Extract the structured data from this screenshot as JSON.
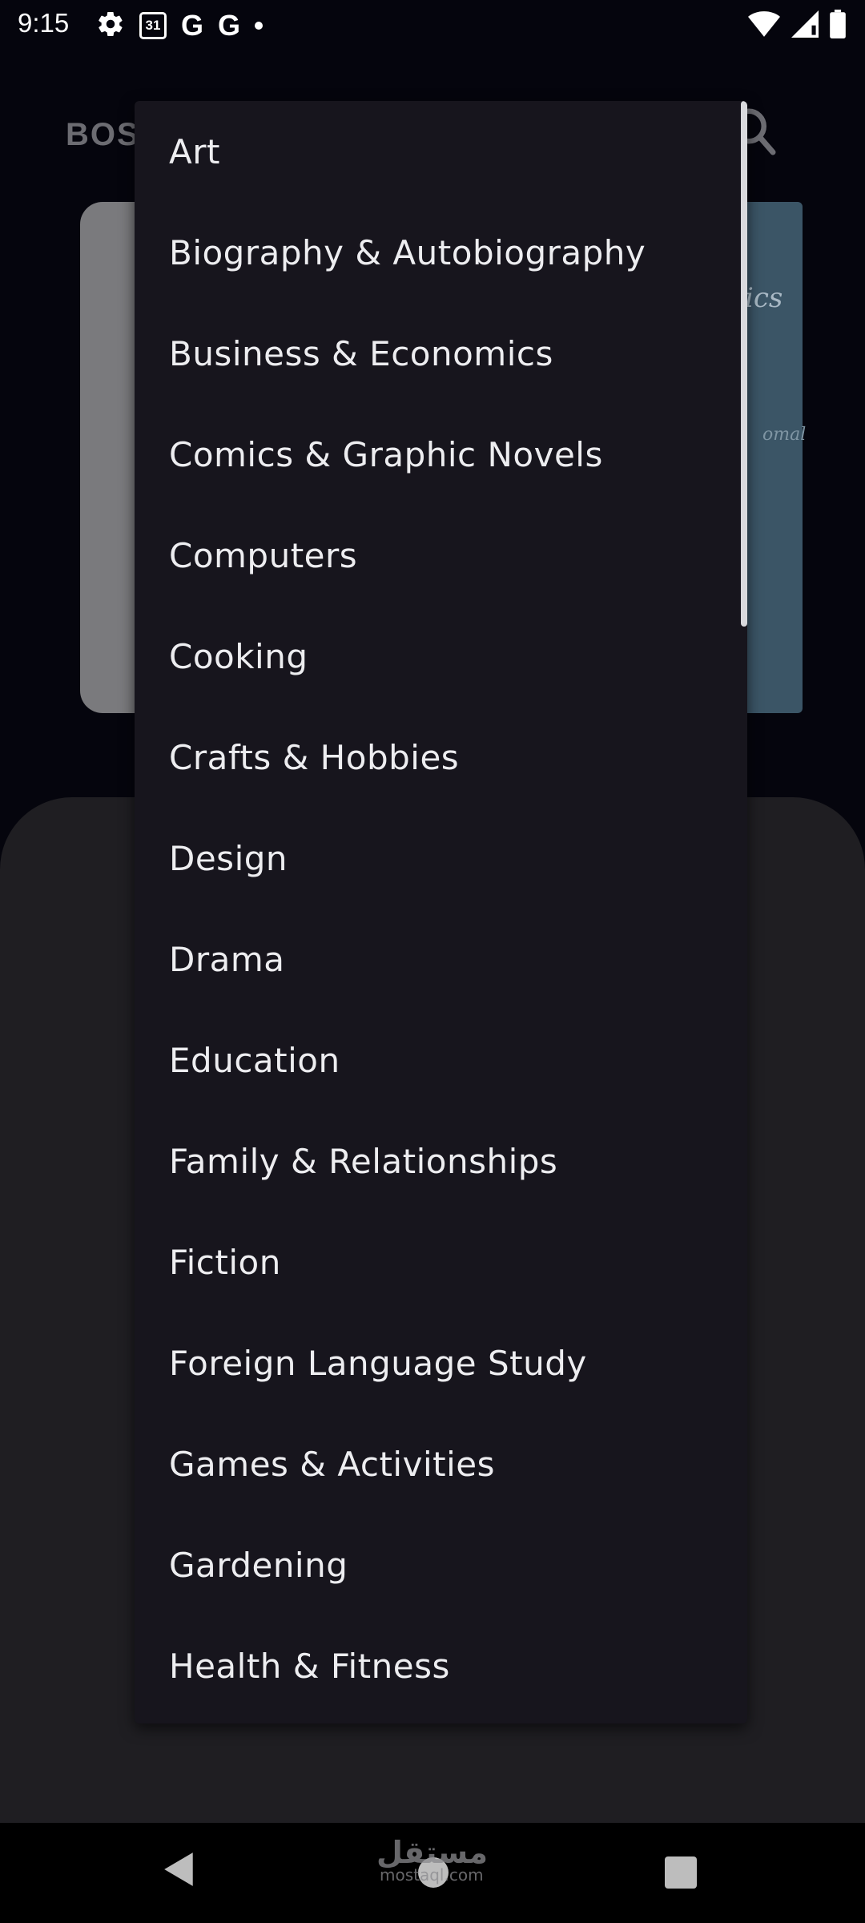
{
  "status_bar": {
    "time": "9:15",
    "calendar_day": "31",
    "g_glyph_1": "G",
    "g_glyph_2": "G"
  },
  "app": {
    "logo_partial": "BOS",
    "cover_text": "ics",
    "cover_text_small": "omal"
  },
  "dropdown": {
    "items": [
      "Art",
      "Biography & Autobiography",
      "Business & Economics",
      "Comics & Graphic Novels",
      "Computers",
      "Cooking",
      "Crafts & Hobbies",
      "Design",
      "Drama",
      "Education",
      "Family & Relationships",
      "Fiction",
      "Foreign Language Study",
      "Games & Activities",
      "Gardening",
      "Health & Fitness"
    ]
  },
  "watermark": {
    "main": "مستقل",
    "sub": "mostaql.com"
  }
}
